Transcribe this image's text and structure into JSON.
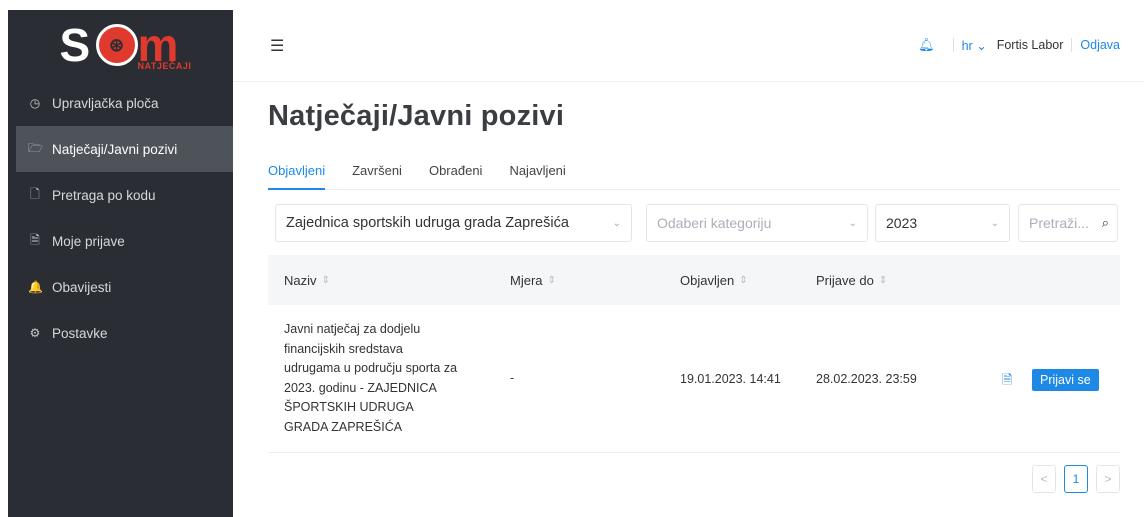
{
  "sidebar": {
    "logo": {
      "text_s": "S",
      "text_m": "m",
      "subtitle": "NATJEČAJI"
    },
    "items": [
      {
        "icon": "dashboard-icon",
        "glyph": "◷",
        "label": "Upravljačka ploča"
      },
      {
        "icon": "folder-open-icon",
        "glyph": "🗁",
        "label": "Natječaji/Javni pozivi"
      },
      {
        "icon": "file-icon",
        "glyph": "🗋",
        "label": "Pretraga po kodu"
      },
      {
        "icon": "file-edit-icon",
        "glyph": "🗎",
        "label": "Moje prijave"
      },
      {
        "icon": "bell-icon",
        "glyph": "🔔",
        "label": "Obavijesti"
      },
      {
        "icon": "settings-icon",
        "glyph": "⚙",
        "label": "Postavke"
      }
    ]
  },
  "header": {
    "lang": "hr",
    "user": "Fortis Labor",
    "logout": "Odjava"
  },
  "page": {
    "title": "Natječaji/Javni pozivi",
    "tabs": [
      "Objavljeni",
      "Završeni",
      "Obrađeni",
      "Najavljeni"
    ]
  },
  "filters": {
    "organization": "Zajednica sportskih udruga grada Zaprešića",
    "category_placeholder": "Odaberi kategoriju",
    "year": "2023",
    "search_placeholder": "Pretraži..."
  },
  "table": {
    "columns": [
      "Naziv",
      "Mjera",
      "Objavljen",
      "Prijave do"
    ],
    "rows": [
      {
        "naziv": "Javni natječaj za dodjelu financijskih sredstava udrugama u području sporta za 2023. godinu - ZAJEDNICA ŠPORTSKIH UDRUGA GRADA ZAPREŠIĆA",
        "mjera": "-",
        "objavljen": "19.01.2023. 14:41",
        "prijave_do": "28.02.2023. 23:59",
        "action": "Prijavi se"
      }
    ]
  },
  "pagination": {
    "prev": "<",
    "current": "1",
    "next": ">"
  },
  "colors": {
    "accent": "#1e88e5",
    "sidebar_bg": "#2a2d33",
    "brand_red": "#e03a2f"
  }
}
